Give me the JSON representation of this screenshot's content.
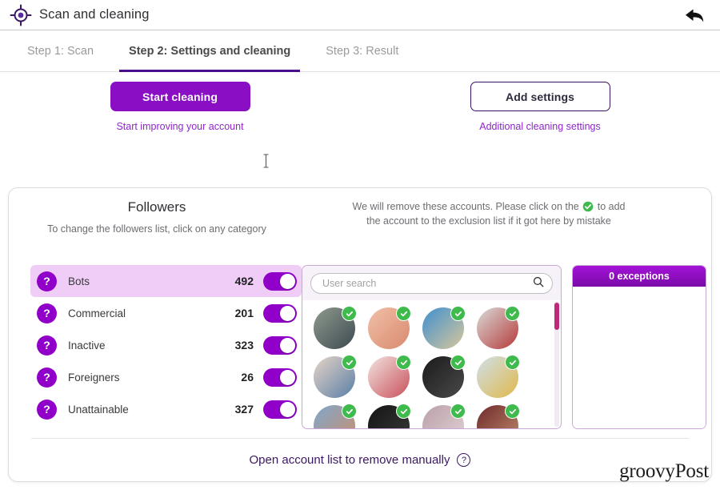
{
  "window": {
    "title": "Scan and cleaning",
    "title_icon": "target-crosshair-icon",
    "back_icon": "back-arrow-icon"
  },
  "tabs": [
    {
      "label": "Step 1: Scan",
      "active": false
    },
    {
      "label": "Step 2: Settings and cleaning",
      "active": true
    },
    {
      "label": "Step 3: Result",
      "active": false
    }
  ],
  "actions": {
    "primary": {
      "label": "Start cleaning",
      "sub": "Start improving your account"
    },
    "secondary": {
      "label": "Add settings",
      "sub": "Additional cleaning settings"
    }
  },
  "followers": {
    "title": "Followers",
    "subtitle": "To change the followers list, click on any category",
    "categories": [
      {
        "icon": "question-icon",
        "label": "Bots",
        "count": "492",
        "enabled": true,
        "selected": true
      },
      {
        "icon": "question-icon",
        "label": "Commercial",
        "count": "201",
        "enabled": true,
        "selected": false
      },
      {
        "icon": "question-icon",
        "label": "Inactive",
        "count": "323",
        "enabled": true,
        "selected": false
      },
      {
        "icon": "question-icon",
        "label": "Foreigners",
        "count": "26",
        "enabled": true,
        "selected": false
      },
      {
        "icon": "question-icon",
        "label": "Unattainable",
        "count": "327",
        "enabled": true,
        "selected": false
      }
    ]
  },
  "accounts": {
    "note_line1_a": "We will remove these accounts. Please click on the",
    "note_line1_b": "to add",
    "note_line2": "the account to the exclusion list if it got here by mistake",
    "search": {
      "placeholder": "User search",
      "value": "",
      "icon": "search-icon"
    },
    "badge_icon": "green-check-icon",
    "items": [
      {
        "alt": "avatar-1",
        "c1": "#8f9a8d",
        "c2": "#3d4a52",
        "badge": true
      },
      {
        "alt": "avatar-2",
        "c1": "#f0c0a8",
        "c2": "#d98a6e",
        "badge": true
      },
      {
        "alt": "avatar-3",
        "c1": "#3f8fd0",
        "c2": "#d8c79a",
        "badge": true
      },
      {
        "alt": "avatar-4",
        "c1": "#d9dbd8",
        "c2": "#b53a3a",
        "badge": true
      },
      {
        "alt": "avatar-5",
        "c1": "#e6d4c6",
        "c2": "#5a7fa8",
        "badge": true
      },
      {
        "alt": "avatar-6",
        "c1": "#f2e4e0",
        "c2": "#c9505a",
        "badge": true
      },
      {
        "alt": "avatar-7",
        "c1": "#1a1a1a",
        "c2": "#4a4a4a",
        "badge": true
      },
      {
        "alt": "avatar-8",
        "c1": "#cfe0ea",
        "c2": "#e0b84a",
        "badge": true
      },
      {
        "alt": "avatar-9",
        "c1": "#7fa7cc",
        "c2": "#cc8f6a",
        "badge": true
      },
      {
        "alt": "avatar-10",
        "c1": "#141414",
        "c2": "#3b3b3b",
        "badge": true
      },
      {
        "alt": "avatar-11",
        "c1": "#b9a0a8",
        "c2": "#e3d2d6",
        "badge": true
      },
      {
        "alt": "avatar-12",
        "c1": "#6e2a2a",
        "c2": "#c08b6e",
        "badge": true
      }
    ]
  },
  "exceptions": {
    "header": "0 exceptions"
  },
  "footer": {
    "link": "Open account list to remove manually",
    "help_icon": "question-circle-icon"
  },
  "watermark": "groovyPost",
  "colors": {
    "accent_purple": "#8a0fc4",
    "accent_dark_purple": "#4b0f8c",
    "toggle_on": "#9100c9",
    "row_selected": "#efcdf6",
    "check_green": "#3fba4d",
    "scrollbar": "#c2277e"
  }
}
